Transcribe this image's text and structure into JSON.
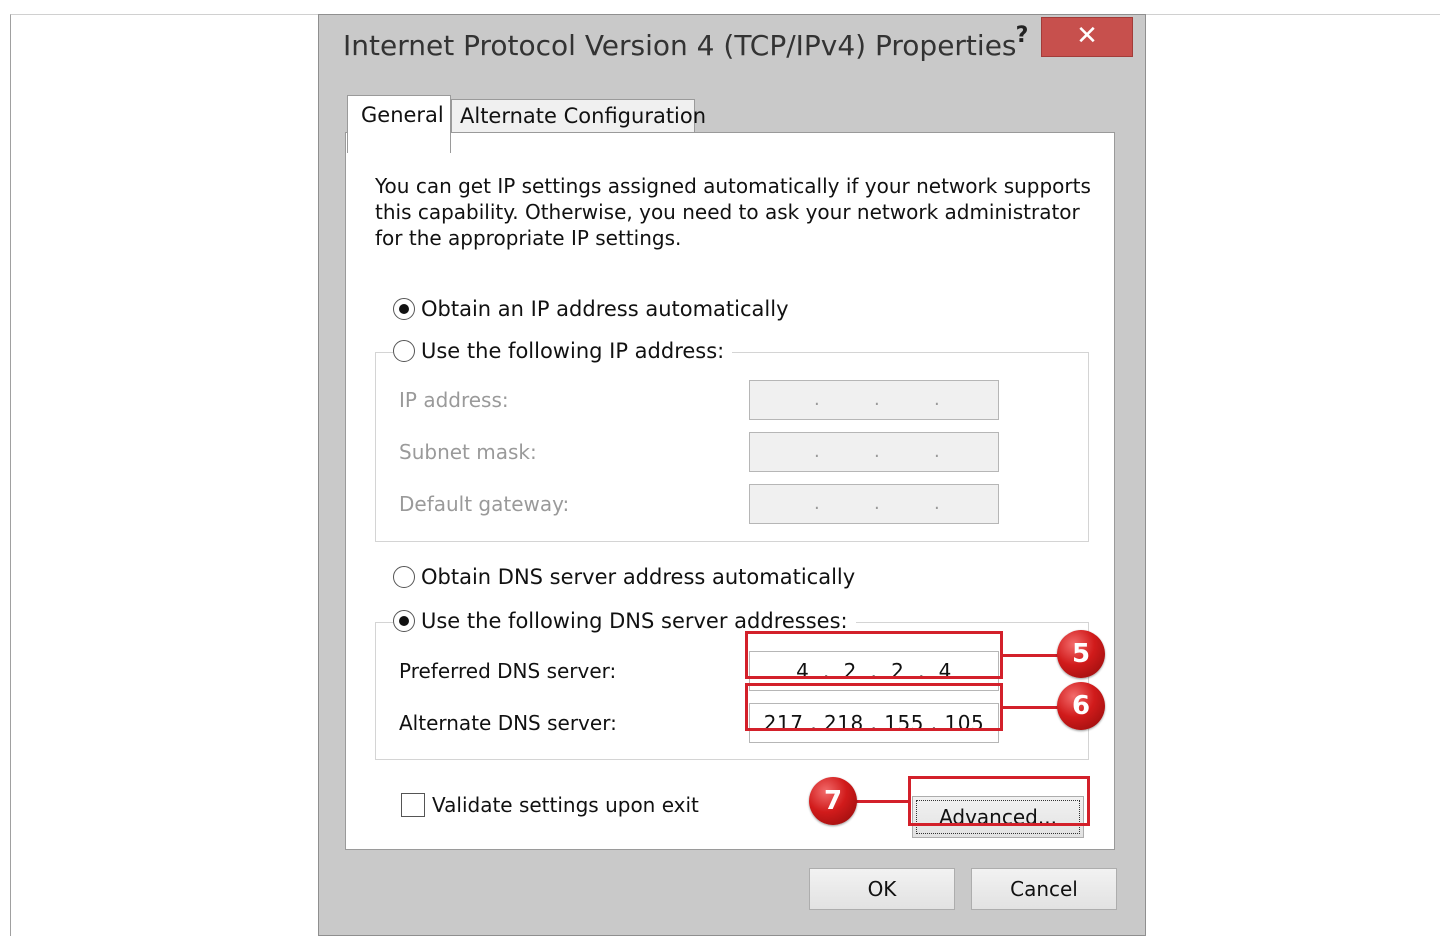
{
  "window": {
    "title": "Internet Protocol Version 4 (TCP/IPv4) Properties",
    "help_label": "?",
    "close_label": "✕"
  },
  "tabs": {
    "general": "General",
    "alternate": "Alternate Configuration"
  },
  "description": {
    "line1": "You can get IP settings assigned automatically if your network supports",
    "line2": "this capability. Otherwise, you need to ask your network administrator",
    "line3": "for the appropriate IP settings."
  },
  "ip": {
    "obtain_auto_label": "Obtain an IP address automatically",
    "obtain_auto_checked": true,
    "use_following_label": "Use the following IP address:",
    "use_following_checked": false,
    "ip_address_label": "IP address:",
    "subnet_mask_label": "Subnet mask:",
    "default_gateway_label": "Default gateway:",
    "ip_address_value": "",
    "subnet_mask_value": "",
    "default_gateway_value": ""
  },
  "dns": {
    "obtain_auto_label": "Obtain DNS server address automatically",
    "obtain_auto_checked": false,
    "use_following_label": "Use the following DNS server addresses:",
    "use_following_checked": true,
    "preferred_label": "Preferred DNS server:",
    "preferred_value": "4  .  2  .  2  .  4",
    "alternate_label": "Alternate DNS server:",
    "alternate_value": "217 . 218 . 155 . 105"
  },
  "validate": {
    "label": "Validate settings upon exit",
    "checked": false
  },
  "buttons": {
    "advanced": "Advanced...",
    "ok": "OK",
    "cancel": "Cancel"
  },
  "annotations": {
    "badge5": "5",
    "badge6": "6",
    "badge7": "7",
    "color": "#d3202a"
  }
}
